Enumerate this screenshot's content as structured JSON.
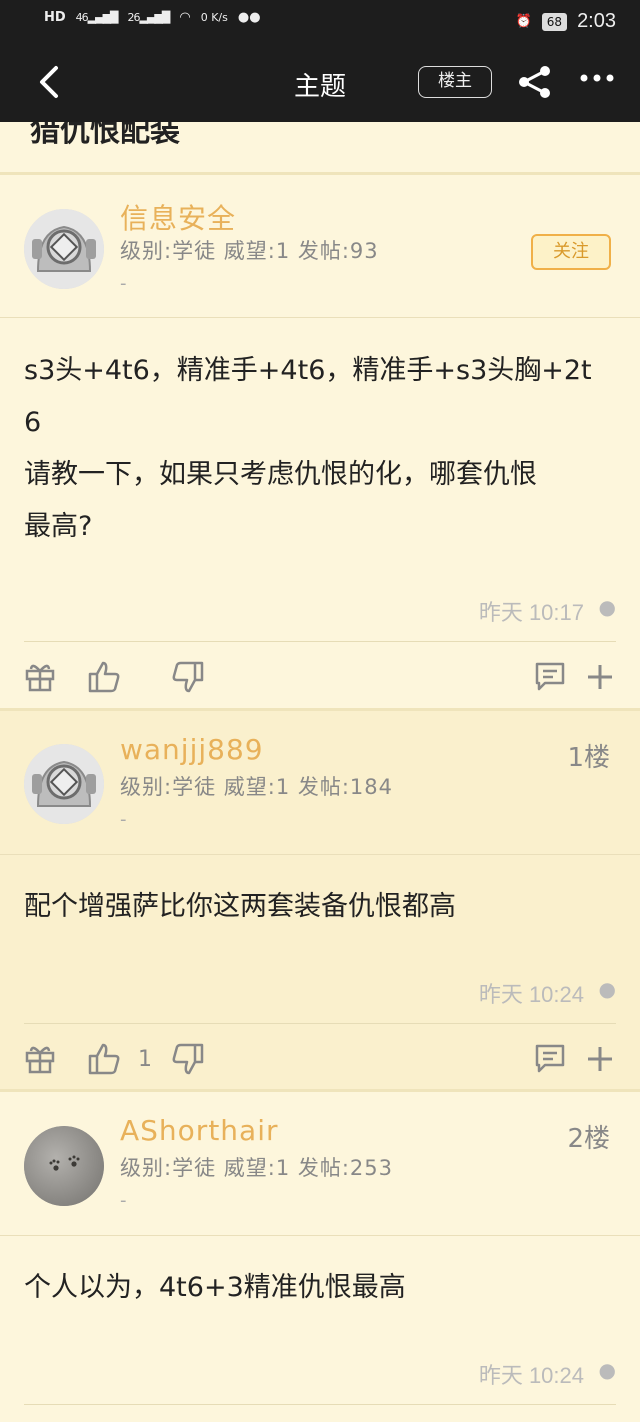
{
  "status_bar": {
    "left": [
      "HD",
      "46",
      "26",
      "0 K/s"
    ],
    "battery": "68",
    "time": "2:03"
  },
  "header": {
    "back_icon": "chevron-left-icon",
    "title": "主题",
    "op_label": "楼主",
    "share_icon": "share-icon",
    "more_icon": "more-icon"
  },
  "thread": {
    "title_clipped": "猎仇恨配装"
  },
  "posts": [
    {
      "username": "信息安全",
      "meta": "级别:学徒 威望:1 发帖:93",
      "dash": "-",
      "follow": "关注",
      "content": [
        "s3头+4t6，精准手+4t6，精准手+s3头胸+2t",
        "6",
        "请教一下，如果只考虑仇恨的化，哪套仇恨",
        "最高?"
      ],
      "time": "昨天 10:17",
      "likes": ""
    },
    {
      "username": "wanjjj889",
      "meta": "级别:学徒 威望:1 发帖:184",
      "dash": "-",
      "floor": "1楼",
      "content": [
        "配个增强萨比你这两套装备仇恨都高"
      ],
      "time": "昨天 10:24",
      "likes": "1"
    },
    {
      "username": "AShorthair",
      "meta": "级别:学徒 威望:1 发帖:253",
      "dash": "-",
      "floor": "2楼",
      "content": [
        "个人以为，4t6+3精准仇恨最高"
      ],
      "time": "昨天 10:24"
    }
  ],
  "colors": {
    "background": "#fdf6dc",
    "username": "#e8b15a",
    "topbar": "#1d1d1d"
  }
}
